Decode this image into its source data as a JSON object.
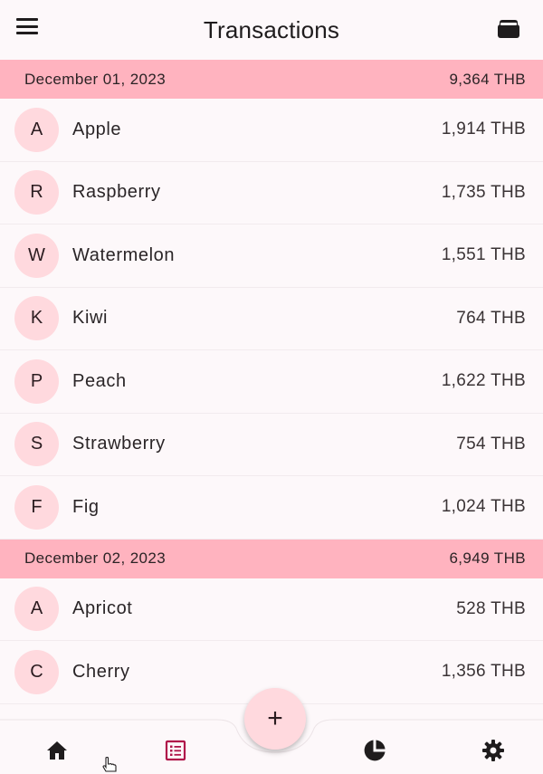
{
  "appbar": {
    "title": "Transactions",
    "menu_icon": "hamburger-menu-icon",
    "wallet_icon": "wallet-icon"
  },
  "groups": [
    {
      "date": "December 01, 2023",
      "total": "9,364 THB",
      "items": [
        {
          "initial": "A",
          "name": "Apple",
          "amount": "1,914 THB"
        },
        {
          "initial": "R",
          "name": "Raspberry",
          "amount": "1,735 THB"
        },
        {
          "initial": "W",
          "name": "Watermelon",
          "amount": "1,551 THB"
        },
        {
          "initial": "K",
          "name": "Kiwi",
          "amount": "764 THB"
        },
        {
          "initial": "P",
          "name": "Peach",
          "amount": "1,622 THB"
        },
        {
          "initial": "S",
          "name": "Strawberry",
          "amount": "754 THB"
        },
        {
          "initial": "F",
          "name": "Fig",
          "amount": "1,024 THB"
        }
      ]
    },
    {
      "date": "December 02, 2023",
      "total": "6,949 THB",
      "items": [
        {
          "initial": "A",
          "name": "Apricot",
          "amount": "528 THB"
        },
        {
          "initial": "C",
          "name": "Cherry",
          "amount": "1,356 THB"
        }
      ]
    }
  ],
  "fab": {
    "label": "+"
  },
  "nav": [
    {
      "icon": "home-icon",
      "active": false
    },
    {
      "icon": "transactions-list-icon",
      "active": true
    },
    {
      "icon": "pie-chart-icon",
      "active": false
    },
    {
      "icon": "settings-gear-icon",
      "active": false
    }
  ],
  "colors": {
    "header_bg": "#ffb3bf",
    "avatar_bg": "#ffd9de",
    "active_nav": "#b0154a",
    "background": "#fdf8fa"
  }
}
